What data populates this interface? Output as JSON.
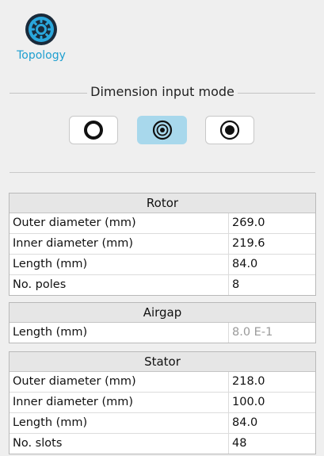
{
  "toolbar": {
    "topology_label": "Topology",
    "topology_icon": "gear-ring-icon",
    "accent_color": "#1e9fd0"
  },
  "dimension_mode": {
    "title": "Dimension input mode",
    "options": [
      {
        "icon": "ring-thick-icon",
        "selected": false
      },
      {
        "icon": "ring-dot-icon",
        "selected": true
      },
      {
        "icon": "ring-solid-dot-icon",
        "selected": false
      }
    ],
    "selected_color": "#a8d8ec"
  },
  "rotor": {
    "title": "Rotor",
    "rows": [
      {
        "label": "Outer diameter (mm)",
        "value": "269.0"
      },
      {
        "label": "Inner diameter (mm)",
        "value": "219.6"
      },
      {
        "label": "Length (mm)",
        "value": "84.0"
      },
      {
        "label": "No. poles",
        "value": "8"
      }
    ]
  },
  "airgap": {
    "title": "Airgap",
    "rows": [
      {
        "label": "Length (mm)",
        "value": "8.0 E-1"
      }
    ]
  },
  "stator": {
    "title": "Stator",
    "rows": [
      {
        "label": "Outer diameter (mm)",
        "value": "218.0"
      },
      {
        "label": "Inner diameter (mm)",
        "value": "100.0"
      },
      {
        "label": "Length (mm)",
        "value": "84.0"
      },
      {
        "label": "No. slots",
        "value": "48"
      }
    ]
  }
}
